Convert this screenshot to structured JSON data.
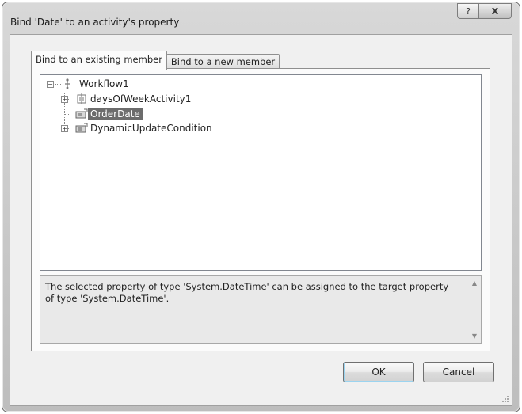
{
  "window": {
    "title": "Bind 'Date' to an activity's property",
    "help_glyph": "?",
    "close_glyph": "X"
  },
  "tabs": [
    {
      "label": "Bind to an existing member",
      "active": true
    },
    {
      "label": "Bind to a new member",
      "active": false
    }
  ],
  "tree": {
    "root": {
      "label": "Workflow1",
      "expanded": true,
      "icon": "workflow-icon"
    },
    "children": [
      {
        "label": "daysOfWeekActivity1",
        "expandable": true,
        "icon": "activity-icon"
      },
      {
        "label": "OrderDate",
        "expandable": false,
        "selected": true,
        "icon": "property-icon"
      },
      {
        "label": "DynamicUpdateCondition",
        "expandable": true,
        "icon": "property-icon"
      }
    ]
  },
  "description": "The selected property of type 'System.DateTime' can be assigned to the target property of type 'System.DateTime'.",
  "buttons": {
    "ok": "OK",
    "cancel": "Cancel"
  },
  "colors": {
    "selection": "#6c6c6c",
    "dialog_bg": "#f0f0f0"
  }
}
